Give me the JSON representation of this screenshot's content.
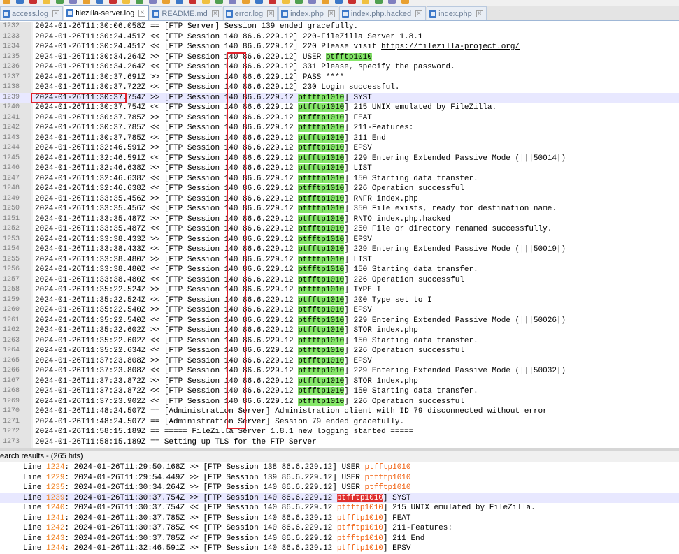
{
  "toolbar": {
    "icons": [
      "new-file-icon",
      "open-icon",
      "save-icon",
      "save-all-icon",
      "close-icon",
      "close-all-icon",
      "print-icon",
      "cut-icon",
      "copy-icon",
      "paste-icon",
      "undo-icon",
      "redo-icon",
      "find-icon",
      "replace-icon",
      "zoom-in-icon",
      "zoom-out-icon",
      "sync-v-icon",
      "sync-h-icon",
      "wrap-icon",
      "all-chars-icon",
      "indent-guide-icon",
      "lang-icon",
      "doc-map-icon",
      "func-list-icon",
      "folder-icon",
      "monitor-icon",
      "record-icon",
      "stop-icon",
      "play-icon",
      "play-multi-icon",
      "save-macro-icon"
    ]
  },
  "tabs": [
    {
      "label": "access.log",
      "active": false
    },
    {
      "label": "filezilla-server.log",
      "active": true
    },
    {
      "label": "README.md",
      "active": false
    },
    {
      "label": "error.log",
      "active": false
    },
    {
      "label": "index.php",
      "active": false
    },
    {
      "label": "index.php.hacked",
      "active": false
    },
    {
      "label": "index.php",
      "active": false
    }
  ],
  "editor": {
    "current_line": 1239,
    "lines": [
      {
        "n": "1232",
        "pre": "2024-01-26T11:30:06.058Z == [FTP Server] Session 139 ended gracefully.",
        "user": "",
        "post": ""
      },
      {
        "n": "1233",
        "pre": "2024-01-26T11:30:24.451Z << [FTP Session 140 86.6.229.12] 220-FileZilla Server 1.8.1",
        "user": "",
        "post": ""
      },
      {
        "n": "1234",
        "pre": "2024-01-26T11:30:24.451Z << [FTP Session 140 86.6.229.12] 220 Please visit ",
        "user": "",
        "post": "",
        "url": "https://filezilla-project.org/"
      },
      {
        "n": "1235",
        "pre": "2024-01-26T11:30:34.264Z >> [FTP Session 140 86.6.229.12] USER ",
        "user": "ptfftp1010",
        "post": ""
      },
      {
        "n": "1236",
        "pre": "2024-01-26T11:30:34.264Z << [FTP Session 140 86.6.229.12] 331 Please, specify the password.",
        "user": "",
        "post": ""
      },
      {
        "n": "1237",
        "pre": "2024-01-26T11:30:37.691Z >> [FTP Session 140 86.6.229.12] PASS ****",
        "user": "",
        "post": ""
      },
      {
        "n": "1238",
        "pre": "2024-01-26T11:30:37.722Z << [FTP Session 140 86.6.229.12] 230 Login successful.",
        "user": "",
        "post": ""
      },
      {
        "n": "1239",
        "pre": "2024-01-26T11:30:37.754Z >> [FTP Session 140 86.6.229.12 ",
        "user": "ptfftp1010",
        "post": "] SYST"
      },
      {
        "n": "1240",
        "pre": "2024-01-26T11:30:37.754Z << [FTP Session 140 86.6.229.12 ",
        "user": "ptfftp1010",
        "post": "] 215 UNIX emulated by FileZilla."
      },
      {
        "n": "1241",
        "pre": "2024-01-26T11:30:37.785Z >> [FTP Session 140 86.6.229.12 ",
        "user": "ptfftp1010",
        "post": "] FEAT"
      },
      {
        "n": "1242",
        "pre": "2024-01-26T11:30:37.785Z << [FTP Session 140 86.6.229.12 ",
        "user": "ptfftp1010",
        "post": "] 211-Features:"
      },
      {
        "n": "1243",
        "pre": "2024-01-26T11:30:37.785Z << [FTP Session 140 86.6.229.12 ",
        "user": "ptfftp1010",
        "post": "] 211 End"
      },
      {
        "n": "1244",
        "pre": "2024-01-26T11:32:46.591Z >> [FTP Session 140 86.6.229.12 ",
        "user": "ptfftp1010",
        "post": "] EPSV"
      },
      {
        "n": "1245",
        "pre": "2024-01-26T11:32:46.591Z << [FTP Session 140 86.6.229.12 ",
        "user": "ptfftp1010",
        "post": "] 229 Entering Extended Passive Mode (|||50014|)"
      },
      {
        "n": "1246",
        "pre": "2024-01-26T11:32:46.638Z >> [FTP Session 140 86.6.229.12 ",
        "user": "ptfftp1010",
        "post": "] LIST"
      },
      {
        "n": "1247",
        "pre": "2024-01-26T11:32:46.638Z << [FTP Session 140 86.6.229.12 ",
        "user": "ptfftp1010",
        "post": "] 150 Starting data transfer."
      },
      {
        "n": "1248",
        "pre": "2024-01-26T11:32:46.638Z << [FTP Session 140 86.6.229.12 ",
        "user": "ptfftp1010",
        "post": "] 226 Operation successful"
      },
      {
        "n": "1249",
        "pre": "2024-01-26T11:33:35.456Z >> [FTP Session 140 86.6.229.12 ",
        "user": "ptfftp1010",
        "post": "] RNFR index.php"
      },
      {
        "n": "1250",
        "pre": "2024-01-26T11:33:35.456Z << [FTP Session 140 86.6.229.12 ",
        "user": "ptfftp1010",
        "post": "] 350 File exists, ready for destination name."
      },
      {
        "n": "1251",
        "pre": "2024-01-26T11:33:35.487Z >> [FTP Session 140 86.6.229.12 ",
        "user": "ptfftp1010",
        "post": "] RNTO index.php.hacked"
      },
      {
        "n": "1252",
        "pre": "2024-01-26T11:33:35.487Z << [FTP Session 140 86.6.229.12 ",
        "user": "ptfftp1010",
        "post": "] 250 File or directory renamed successfully."
      },
      {
        "n": "1253",
        "pre": "2024-01-26T11:33:38.433Z >> [FTP Session 140 86.6.229.12 ",
        "user": "ptfftp1010",
        "post": "] EPSV"
      },
      {
        "n": "1254",
        "pre": "2024-01-26T11:33:38.433Z << [FTP Session 140 86.6.229.12 ",
        "user": "ptfftp1010",
        "post": "] 229 Entering Extended Passive Mode (|||50019|)"
      },
      {
        "n": "1255",
        "pre": "2024-01-26T11:33:38.480Z >> [FTP Session 140 86.6.229.12 ",
        "user": "ptfftp1010",
        "post": "] LIST"
      },
      {
        "n": "1256",
        "pre": "2024-01-26T11:33:38.480Z << [FTP Session 140 86.6.229.12 ",
        "user": "ptfftp1010",
        "post": "] 150 Starting data transfer."
      },
      {
        "n": "1257",
        "pre": "2024-01-26T11:33:38.480Z << [FTP Session 140 86.6.229.12 ",
        "user": "ptfftp1010",
        "post": "] 226 Operation successful"
      },
      {
        "n": "1258",
        "pre": "2024-01-26T11:35:22.524Z >> [FTP Session 140 86.6.229.12 ",
        "user": "ptfftp1010",
        "post": "] TYPE I"
      },
      {
        "n": "1259",
        "pre": "2024-01-26T11:35:22.524Z << [FTP Session 140 86.6.229.12 ",
        "user": "ptfftp1010",
        "post": "] 200 Type set to I"
      },
      {
        "n": "1260",
        "pre": "2024-01-26T11:35:22.540Z >> [FTP Session 140 86.6.229.12 ",
        "user": "ptfftp1010",
        "post": "] EPSV"
      },
      {
        "n": "1261",
        "pre": "2024-01-26T11:35:22.540Z << [FTP Session 140 86.6.229.12 ",
        "user": "ptfftp1010",
        "post": "] 229 Entering Extended Passive Mode (|||50026|)"
      },
      {
        "n": "1262",
        "pre": "2024-01-26T11:35:22.602Z >> [FTP Session 140 86.6.229.12 ",
        "user": "ptfftp1010",
        "post": "] STOR index.php"
      },
      {
        "n": "1263",
        "pre": "2024-01-26T11:35:22.602Z << [FTP Session 140 86.6.229.12 ",
        "user": "ptfftp1010",
        "post": "] 150 Starting data transfer."
      },
      {
        "n": "1264",
        "pre": "2024-01-26T11:35:22.634Z << [FTP Session 140 86.6.229.12 ",
        "user": "ptfftp1010",
        "post": "] 226 Operation successful"
      },
      {
        "n": "1265",
        "pre": "2024-01-26T11:37:23.808Z >> [FTP Session 140 86.6.229.12 ",
        "user": "ptfftp1010",
        "post": "] EPSV"
      },
      {
        "n": "1266",
        "pre": "2024-01-26T11:37:23.808Z << [FTP Session 140 86.6.229.12 ",
        "user": "ptfftp1010",
        "post": "] 229 Entering Extended Passive Mode (|||50032|)"
      },
      {
        "n": "1267",
        "pre": "2024-01-26T11:37:23.872Z >> [FTP Session 140 86.6.229.12 ",
        "user": "ptfftp1010",
        "post": "] STOR 1ndex.php"
      },
      {
        "n": "1268",
        "pre": "2024-01-26T11:37:23.872Z << [FTP Session 140 86.6.229.12 ",
        "user": "ptfftp1010",
        "post": "] 150 Starting data transfer."
      },
      {
        "n": "1269",
        "pre": "2024-01-26T11:37:23.902Z << [FTP Session 140 86.6.229.12 ",
        "user": "ptfftp1010",
        "post": "] 226 Operation successful"
      },
      {
        "n": "1270",
        "pre": "2024-01-26T11:48:24.507Z == [Administration Server] Administration client with ID 79 disconnected without error",
        "user": "",
        "post": ""
      },
      {
        "n": "1271",
        "pre": "2024-01-26T11:48:24.507Z == [Administration Server] Session 79 ended gracefully.",
        "user": "",
        "post": ""
      },
      {
        "n": "1272",
        "pre": "2024-01-26T11:58:15.189Z == ===== FileZilla Server 1.8.1 new logging started =====",
        "user": "",
        "post": ""
      },
      {
        "n": "1273",
        "pre": "2024-01-26T11:58:15.189Z == Setting up TLS for the FTP Server",
        "user": "",
        "post": ""
      }
    ]
  },
  "search": {
    "header": "earch results - (265 hits)",
    "results": [
      {
        "label": "Line ",
        "num": "1224",
        "pre": ": 2024-01-26T11:29:50.168Z >> [FTP Session 138 86.6.229.12] USER ",
        "key": "ptfftp1010",
        "post": "",
        "current": false
      },
      {
        "label": "Line ",
        "num": "1229",
        "pre": ": 2024-01-26T11:29:54.449Z >> [FTP Session 139 86.6.229.12] USER ",
        "key": "ptfftp1010",
        "post": "",
        "current": false
      },
      {
        "label": "Line ",
        "num": "1235",
        "pre": ": 2024-01-26T11:30:34.264Z >> [FTP Session 140 86.6.229.12] USER ",
        "key": "ptfftp1010",
        "post": "",
        "current": false
      },
      {
        "label": "Line ",
        "num": "1239",
        "pre": ": 2024-01-26T11:30:37.754Z >> [FTP Session 140 86.6.229.12 ",
        "key": "ptfftp1010",
        "post": "] SYST",
        "current": true
      },
      {
        "label": "Line ",
        "num": "1240",
        "pre": ": 2024-01-26T11:30:37.754Z << [FTP Session 140 86.6.229.12 ",
        "key": "ptfftp1010",
        "post": "] 215 UNIX emulated by FileZilla.",
        "current": false
      },
      {
        "label": "Line ",
        "num": "1241",
        "pre": ": 2024-01-26T11:30:37.785Z >> [FTP Session 140 86.6.229.12 ",
        "key": "ptfftp1010",
        "post": "] FEAT",
        "current": false
      },
      {
        "label": "Line ",
        "num": "1242",
        "pre": ": 2024-01-26T11:30:37.785Z << [FTP Session 140 86.6.229.12 ",
        "key": "ptfftp1010",
        "post": "] 211-Features:",
        "current": false
      },
      {
        "label": "Line ",
        "num": "1243",
        "pre": ": 2024-01-26T11:30:37.785Z << [FTP Session 140 86.6.229.12 ",
        "key": "ptfftp1010",
        "post": "] 211 End",
        "current": false
      },
      {
        "label": "Line ",
        "num": "1244",
        "pre": ": 2024-01-26T11:32:46.591Z >> [FTP Session 140 86.6.229.12 ",
        "key": "ptfftp1010",
        "post": "] EPSV",
        "current": false
      }
    ]
  },
  "colors": {
    "user_highlight": "#86e86a",
    "annotation_box": "#e0202a",
    "current_line": "#e8e8ff",
    "search_line_number": "#f08020"
  }
}
